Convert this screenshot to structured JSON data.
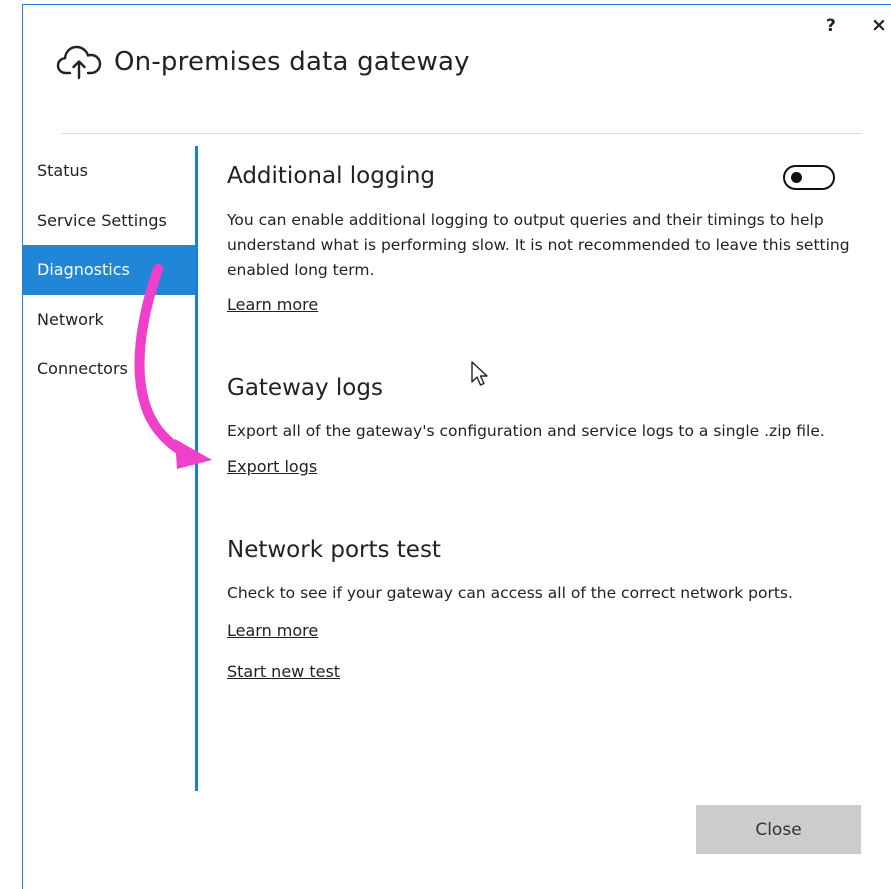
{
  "window": {
    "title": "On-premises data gateway",
    "help_label": "?",
    "close_label": "×",
    "icon": "cloud-upload-icon"
  },
  "sidebar": {
    "items": [
      {
        "label": "Status",
        "active": false
      },
      {
        "label": "Service Settings",
        "active": false
      },
      {
        "label": "Diagnostics",
        "active": true
      },
      {
        "label": "Network",
        "active": false
      },
      {
        "label": "Connectors",
        "active": false
      }
    ]
  },
  "sections": {
    "additional_logging": {
      "title": "Additional logging",
      "description": "You can enable additional logging to output queries and their timings to help understand what is performing slow. It is not recommended to leave this setting enabled long term.",
      "learn_more": "Learn more",
      "toggle_on": false
    },
    "gateway_logs": {
      "title": "Gateway logs",
      "description": "Export all of the gateway's configuration and service logs to a single .zip file.",
      "export_link": "Export logs"
    },
    "network_ports_test": {
      "title": "Network ports test",
      "description": "Check to see if your gateway can access all of the correct network ports.",
      "learn_more": "Learn more",
      "start_test": "Start new test"
    }
  },
  "footer": {
    "close_button": "Close"
  },
  "colors": {
    "accent": "#1f86d8",
    "annotation_arrow": "#f03fc8",
    "button_bg": "#cccccc"
  }
}
